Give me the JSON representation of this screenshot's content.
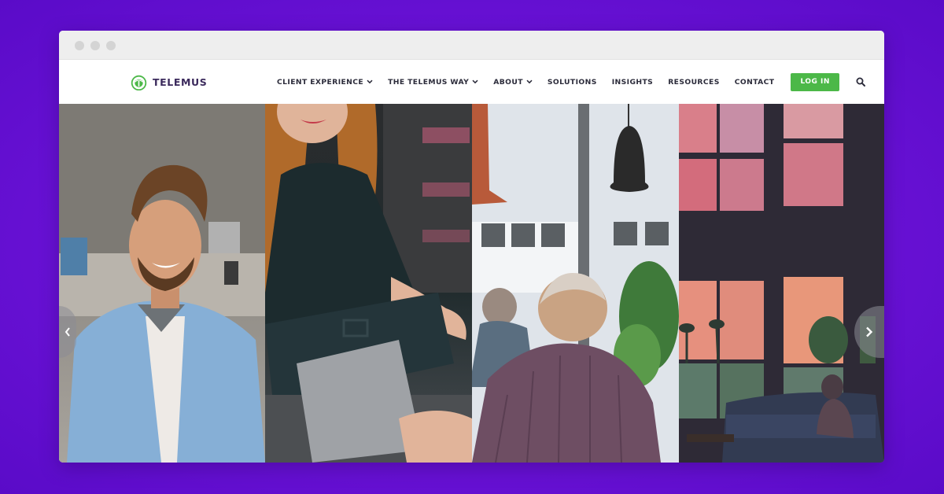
{
  "brand": {
    "name": "TELEMUS"
  },
  "nav": {
    "items": [
      {
        "label": "CLIENT EXPERIENCE",
        "dropdown": true
      },
      {
        "label": "THE TELEMUS WAY",
        "dropdown": true
      },
      {
        "label": "ABOUT",
        "dropdown": true
      },
      {
        "label": "SOLUTIONS",
        "dropdown": false
      },
      {
        "label": "INSIGHTS",
        "dropdown": false
      },
      {
        "label": "RESOURCES",
        "dropdown": false
      },
      {
        "label": "CONTACT",
        "dropdown": false
      }
    ],
    "login_label": "LOG IN",
    "search_icon": "search-icon"
  },
  "hero": {
    "panels": [
      "smiling-man-office",
      "woman-with-tablet",
      "older-man-window",
      "living-room-sunset"
    ],
    "carousel": {
      "prev_icon": "chevron-left-icon",
      "next_icon": "chevron-right-icon"
    }
  },
  "colors": {
    "background": "#6a12d6",
    "login_button": "#4cb848",
    "logo_green": "#4cb848",
    "logo_text": "#3b2a5c"
  }
}
